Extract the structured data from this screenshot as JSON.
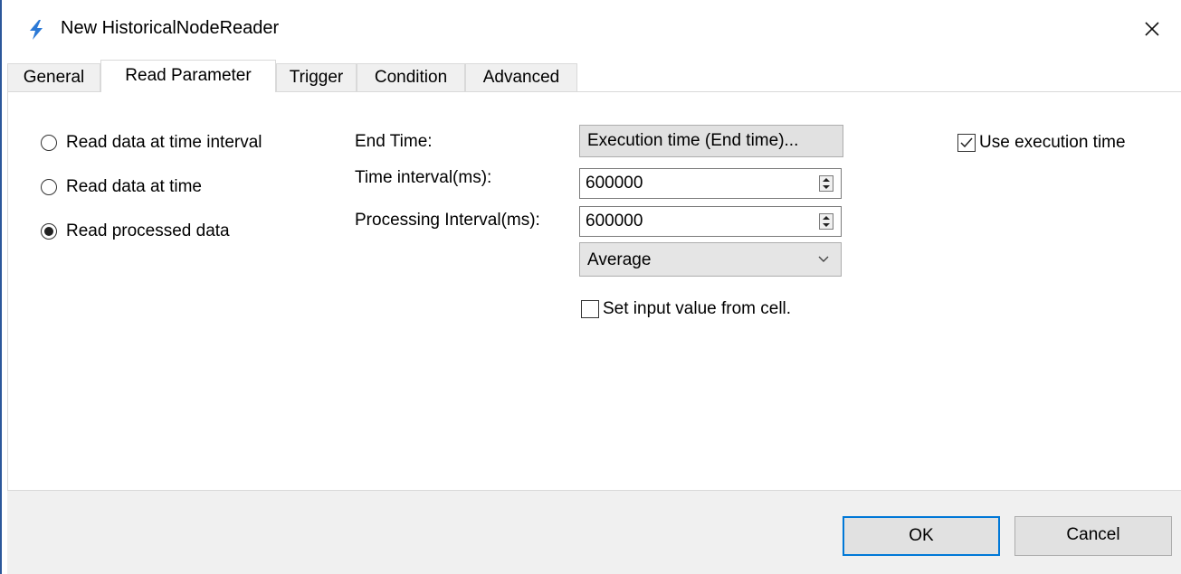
{
  "window": {
    "title": "New HistoricalNodeReader",
    "icon": "lightning-icon",
    "accent_color": "#2b79d6"
  },
  "tabs": [
    {
      "label": "General",
      "active": false
    },
    {
      "label": "Read Parameter",
      "active": true
    },
    {
      "label": "Trigger",
      "active": false
    },
    {
      "label": "Condition",
      "active": false
    },
    {
      "label": "Advanced",
      "active": false
    }
  ],
  "read_mode": {
    "options": [
      {
        "label": "Read data at time interval",
        "checked": false
      },
      {
        "label": "Read data at time",
        "checked": false
      },
      {
        "label": "Read processed data",
        "checked": true
      }
    ]
  },
  "params": {
    "end_time_label": "End Time:",
    "end_time_value": "Execution time (End time)...",
    "time_interval_label": "Time interval(ms):",
    "time_interval_value": "600000",
    "processing_interval_label": "Processing Interval(ms):",
    "processing_interval_value": "600000",
    "aggregate_value": "Average",
    "set_input_from_cell_label": "Set input value from cell.",
    "set_input_from_cell_checked": false,
    "use_execution_time_label": "Use execution time",
    "use_execution_time_checked": true
  },
  "footer": {
    "ok_label": "OK",
    "cancel_label": "Cancel"
  }
}
